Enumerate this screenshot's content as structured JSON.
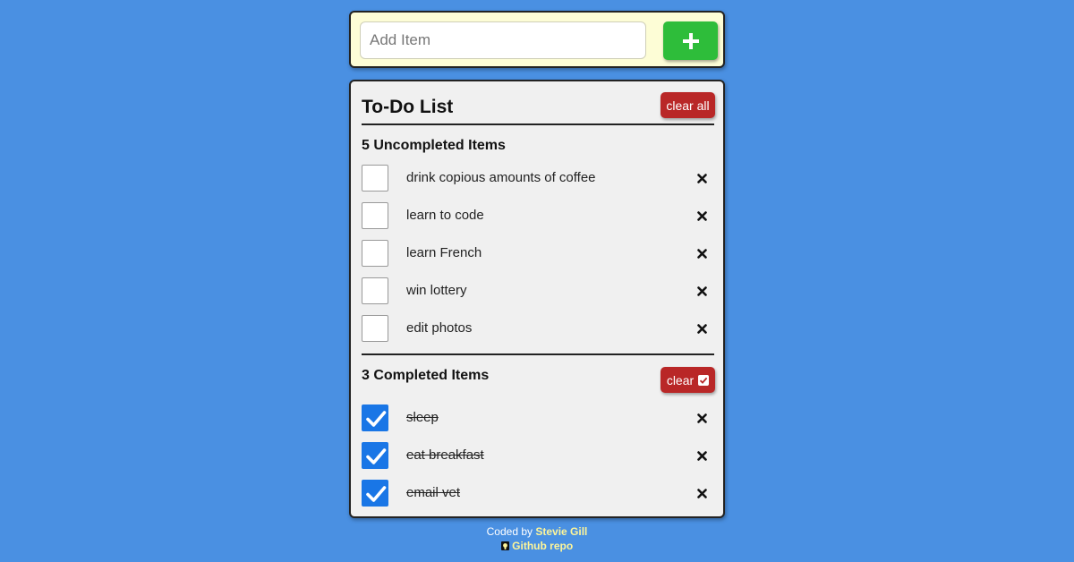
{
  "add_form": {
    "placeholder": "Add Item",
    "value": "",
    "add_button_icon": "plus-icon"
  },
  "list": {
    "title": "To-Do List",
    "clear_all_label": "clear all",
    "uncompleted_heading": "5 Uncompleted Items",
    "completed_heading": "3 Completed Items",
    "clear_completed_label": "clear",
    "clear_completed_icon": "checked-box-icon",
    "uncompleted": [
      {
        "text": "drink copious amounts of coffee",
        "checked": false
      },
      {
        "text": "learn to code",
        "checked": false
      },
      {
        "text": "learn French",
        "checked": false
      },
      {
        "text": "win lottery",
        "checked": false
      },
      {
        "text": "edit photos",
        "checked": false
      }
    ],
    "completed": [
      {
        "text": "sleep",
        "checked": true
      },
      {
        "text": "eat breakfast",
        "checked": true
      },
      {
        "text": "email vet",
        "checked": true
      }
    ]
  },
  "footer": {
    "coded_by_label": "Coded by",
    "author": "Stevie Gill",
    "repo_icon": "github-icon",
    "repo_label": "Github repo"
  },
  "colors": {
    "background": "#4a90e2",
    "add_card": "#fdfdd6",
    "add_button": "#2ebd3a",
    "danger": "#b92727",
    "checkbox_checked": "#1976e6",
    "footer_link": "#fdf59a"
  }
}
